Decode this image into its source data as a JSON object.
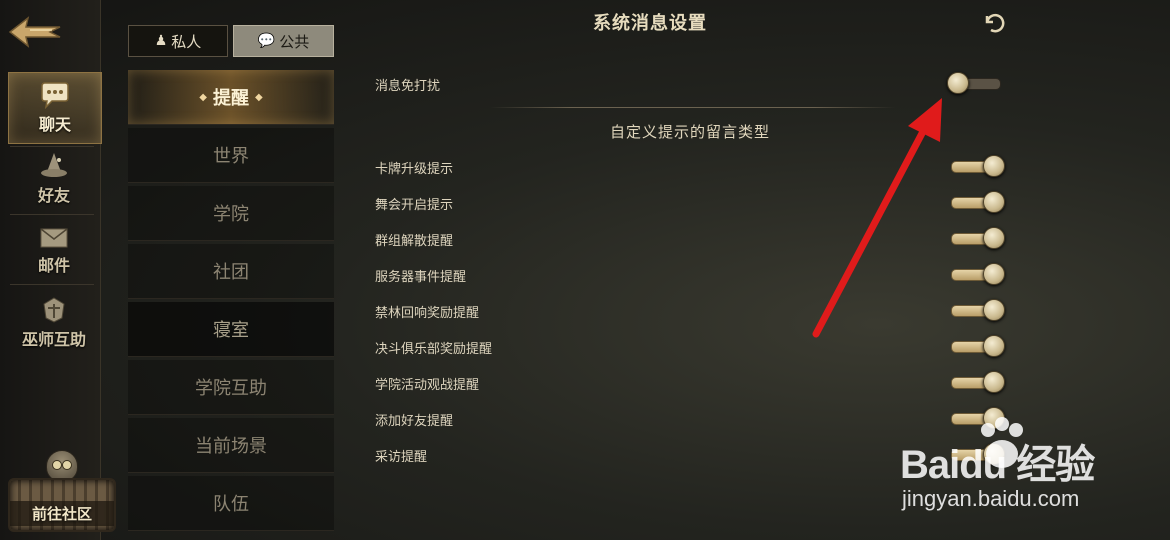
{
  "nav": {
    "items": [
      {
        "label": "聊天",
        "icon": "chat-bubble-icon",
        "active": true
      },
      {
        "label": "好友",
        "icon": "wizard-hat-icon",
        "active": false
      },
      {
        "label": "邮件",
        "icon": "envelope-icon",
        "active": false
      },
      {
        "label": "巫师互助",
        "icon": "crest-icon",
        "active": false
      }
    ],
    "community_label": "前往社区"
  },
  "tabs": {
    "private_label": "私人",
    "public_label": "公共",
    "selected": "public"
  },
  "channels": [
    {
      "label": "提醒",
      "active": true
    },
    {
      "label": "世界",
      "active": false
    },
    {
      "label": "学院",
      "active": false
    },
    {
      "label": "社团",
      "active": false
    },
    {
      "label": "寝室",
      "active": false
    },
    {
      "label": "学院互助",
      "active": false
    },
    {
      "label": "当前场景",
      "active": false
    },
    {
      "label": "队伍",
      "active": false
    }
  ],
  "settings": {
    "title": "系统消息设置",
    "dnd_label": "消息免打扰",
    "dnd_on": false,
    "section_title": "自定义提示的留言类型",
    "items": [
      {
        "label": "卡牌升级提示",
        "on": true
      },
      {
        "label": "舞会开启提示",
        "on": true
      },
      {
        "label": "群组解散提醒",
        "on": true
      },
      {
        "label": "服务器事件提醒",
        "on": true
      },
      {
        "label": "禁林回响奖励提醒",
        "on": true
      },
      {
        "label": "决斗俱乐部奖励提醒",
        "on": true
      },
      {
        "label": "学院活动观战提醒",
        "on": true
      },
      {
        "label": "添加好友提醒",
        "on": true
      },
      {
        "label": "采访提醒",
        "on": true
      }
    ]
  },
  "watermark": {
    "brand": "Baidu 经验",
    "url": "jingyan.baidu.com"
  },
  "colors": {
    "accent_gold": "#c9a66b",
    "annotation_red": "#e01b1b"
  }
}
